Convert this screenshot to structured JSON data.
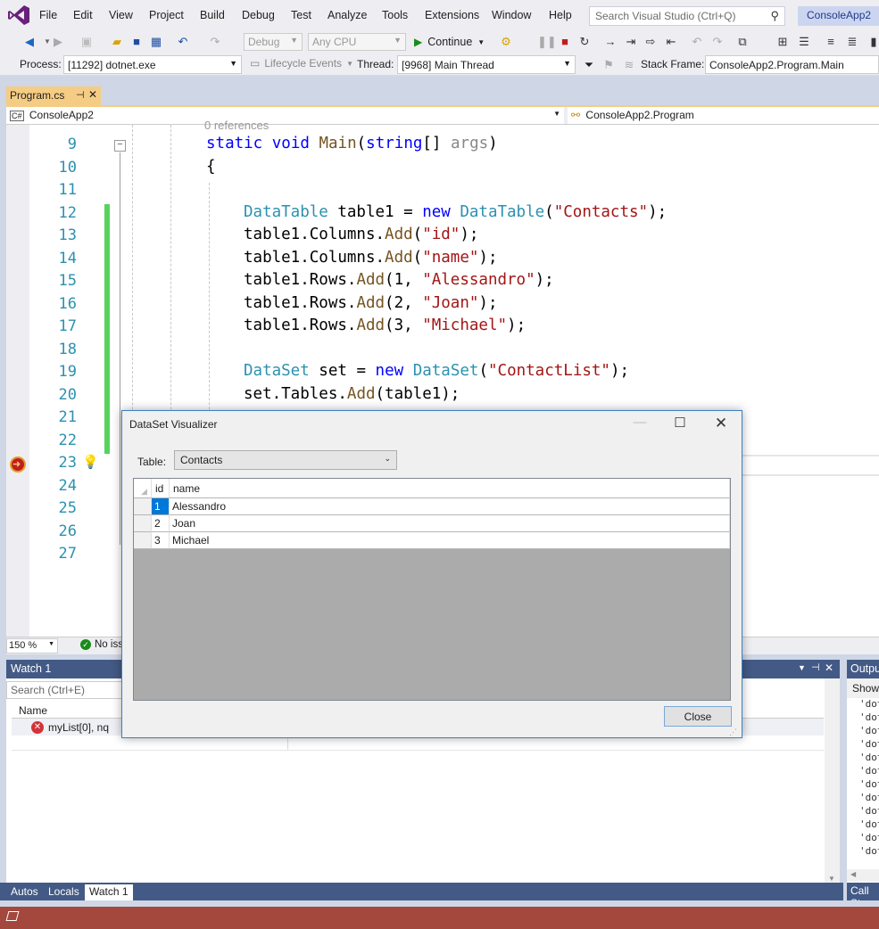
{
  "menu": [
    "File",
    "Edit",
    "View",
    "Project",
    "Build",
    "Debug",
    "Test",
    "Analyze",
    "Tools",
    "Extensions",
    "Window",
    "Help"
  ],
  "search_placeholder": "Search Visual Studio (Ctrl+Q)",
  "app_title": "ConsoleApp2",
  "toolbar1": {
    "config": "Debug",
    "platform": "Any CPU",
    "continue": "Continue"
  },
  "toolbar2": {
    "process_label": "Process:",
    "process_value": "[11292] dotnet.exe",
    "lifecycle": "Lifecycle Events",
    "thread_label": "Thread:",
    "thread_value": "[9968] Main Thread",
    "stack_label": "Stack Frame:",
    "stack_value": "ConsoleApp2.Program.Main"
  },
  "tab": {
    "name": "Program.cs"
  },
  "navbar": {
    "project": "ConsoleApp2",
    "class": "ConsoleApp2.Program"
  },
  "editor": {
    "references": "0 references",
    "line_numbers": [
      "9",
      "10",
      "11",
      "12",
      "13",
      "14",
      "15",
      "16",
      "17",
      "18",
      "19",
      "20",
      "21",
      "22",
      "23",
      "24",
      "25",
      "26",
      "27"
    ],
    "code": {
      "l9_a": "static",
      "l9_b": "void",
      "l9_c": "Main",
      "l9_d": "(",
      "l9_e": "string",
      "l9_f": "[] ",
      "l9_g": "args",
      "l9_h": ")",
      "l10": "{",
      "l12_a": "DataTable",
      "l12_b": " table1 = ",
      "l12_c": "new",
      "l12_d": "DataTable",
      "l12_e": "(",
      "l12_f": "\"Contacts\"",
      "l12_g": ");",
      "l13_a": "table1.Columns.",
      "l13_b": "Add",
      "l13_c": "(",
      "l13_d": "\"id\"",
      "l13_e": ");",
      "l14_a": "table1.Columns.",
      "l14_b": "Add",
      "l14_c": "(",
      "l14_d": "\"name\"",
      "l14_e": ");",
      "l15_a": "table1.Rows.",
      "l15_b": "Add",
      "l15_c": "(1, ",
      "l15_d": "\"Alessandro\"",
      "l15_e": ");",
      "l16_a": "table1.Rows.",
      "l16_b": "Add",
      "l16_c": "(2, ",
      "l16_d": "\"Joan\"",
      "l16_e": ");",
      "l17_a": "table1.Rows.",
      "l17_b": "Add",
      "l17_c": "(3, ",
      "l17_d": "\"Michael\"",
      "l17_e": ");",
      "l19_a": "DataSet",
      "l19_b": " set = ",
      "l19_c": "new",
      "l19_d": "DataSet",
      "l19_e": "(",
      "l19_f": "\"ContactList\"",
      "l19_g": ");",
      "l20_a": "set.Tables.",
      "l20_b": "Add",
      "l20_c": "(table1);"
    }
  },
  "editor_status": {
    "zoom": "150 %",
    "issues": "No iss"
  },
  "watch": {
    "title": "Watch 1",
    "search_placeholder": "Search (Ctrl+E)",
    "col_name": "Name",
    "row_name": "myList[0], nq"
  },
  "bottom_tabs": [
    "Autos",
    "Locals",
    "Watch 1"
  ],
  "output": {
    "title": "Outpu",
    "show": "Show",
    "line_prefix": "'dot",
    "callstack": "Call St"
  },
  "dialog": {
    "title": "DataSet Visualizer",
    "table_label": "Table:",
    "table_value": "Contacts",
    "columns": [
      "id",
      "name"
    ],
    "rows": [
      [
        "1",
        "Alessandro"
      ],
      [
        "2",
        "Joan"
      ],
      [
        "3",
        "Michael"
      ]
    ],
    "close": "Close"
  },
  "colors": {
    "accent": "#435a86",
    "tab": "#f5cc84",
    "statusbar": "#a4473c",
    "selection": "#0078d7"
  }
}
